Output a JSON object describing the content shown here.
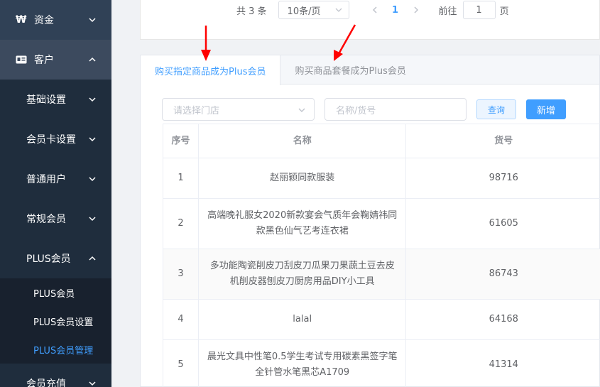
{
  "sidebar": {
    "funds": {
      "icon": "₩",
      "label": "资金"
    },
    "customer": {
      "label": "客户"
    },
    "sub_items": [
      {
        "label": "基础设置"
      },
      {
        "label": "会员卡设置"
      },
      {
        "label": "普通用户"
      },
      {
        "label": "常规会员"
      }
    ],
    "plus": {
      "label": "PLUS会员"
    },
    "plus_children": [
      {
        "label": "PLUS会员"
      },
      {
        "label": "PLUS会员设置"
      },
      {
        "label": "PLUS会员管理"
      }
    ],
    "recharge": {
      "label": "会员充值"
    }
  },
  "pagination": {
    "total": "共 3 条",
    "page_size": "10条/页",
    "current_page": "1",
    "goto_label": "前往",
    "goto_value": "1",
    "goto_suffix": "页"
  },
  "tabs": [
    {
      "label": "购买指定商品成为Plus会员",
      "active": true
    },
    {
      "label": "购买商品套餐成为Plus会员",
      "active": false
    }
  ],
  "filters": {
    "store_placeholder": "请选择门店",
    "name_placeholder": "名称/货号",
    "query_label": "查询",
    "add_label": "新增"
  },
  "table": {
    "headers": {
      "index": "序号",
      "name": "名称",
      "sku": "货号"
    },
    "rows": [
      {
        "index": "1",
        "name": "赵丽颖同款服装",
        "sku": "98716"
      },
      {
        "index": "2",
        "name": "高端晚礼服女2020新款宴会气质年会鞠婧祎同款黑色仙气艺考连衣裙",
        "sku": "61605"
      },
      {
        "index": "3",
        "name": "多功能陶瓷削皮刀刮皮刀瓜果刀果蔬土豆去皮机削皮器刨皮刀厨房用品DIY小工具",
        "sku": "86743"
      },
      {
        "index": "4",
        "name": "lalal",
        "sku": "64168"
      },
      {
        "index": "5",
        "name": "晨光文具中性笔0.5学生考试专用碳素黑签字笔全针管水笔黑芯A1709",
        "sku": "41314"
      }
    ]
  },
  "colors": {
    "accent": "#409eff",
    "sidebar_bg": "#304156",
    "annotation_arrow": "#ff0000"
  }
}
